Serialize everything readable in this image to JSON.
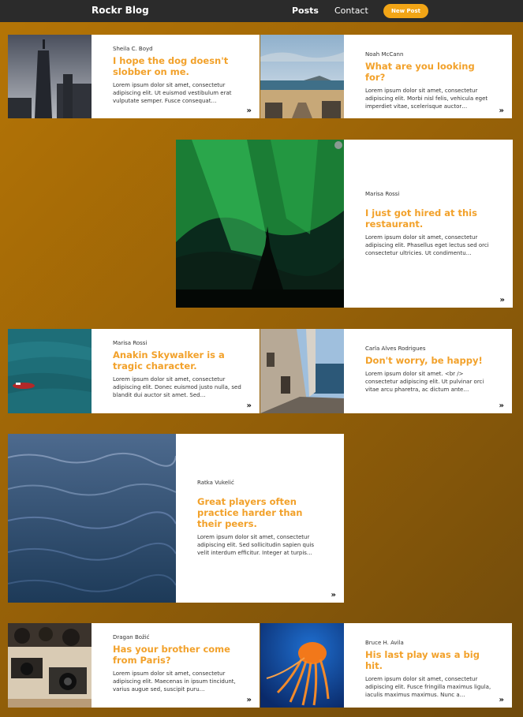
{
  "nav": {
    "brand": "Rockr Blog",
    "links": [
      "Posts",
      "Contact"
    ],
    "new_post_label": "New Post"
  },
  "colors": {
    "accent": "#f2a516",
    "title": "#f2a12a",
    "navbar": "#2b2b2b",
    "background_start": "#b57506",
    "background_end": "#6f4a0c"
  },
  "posts": [
    {
      "author": "Sheila C. Boyd",
      "title": "I hope the dog doesn't slobber on me.",
      "excerpt": "Lorem ipsum dolor sit amet, consectetur adipiscing elit. Ut euismod vestibulum erat vulputate semper. Fusce consequat…",
      "image": "city-skyscraper-photo"
    },
    {
      "author": "Noah McCann",
      "title": "What are you looking for?",
      "excerpt": "Lorem ipsum dolor sit amet, consectetur adipiscing elit. Morbi nisl felis, vehicula eget imperdiet vitae, scelerisque auctor…",
      "image": "beach-boardwalk-photo"
    },
    {
      "author": "Marisa Rossi",
      "title": "I just got hired at this restaurant.",
      "excerpt": "Lorem ipsum dolor sit amet, consectetur adipiscing elit. Phasellus eget lectus sed orci consectetur ultricies. Ut condimentu…",
      "image": "aurora-borealis-photo"
    },
    {
      "author": "Marisa Rossi",
      "title": "Anakin Skywalker is a tragic character.",
      "excerpt": "Lorem ipsum dolor sit amet, consectetur adipiscing elit. Donec euismod justo nulla, sed blandit dui auctor sit amet. Sed…",
      "image": "boat-on-sea-photo"
    },
    {
      "author": "Carla Alves Rodrigues",
      "title": "Don't worry, be happy!",
      "excerpt": "Lorem ipsum dolor sit amet. <br /> consectetur adipiscing elit. Ut pulvinar orci vitae arcu pharetra, ac dictum ante…",
      "image": "coastal-alley-photo"
    },
    {
      "author": "Ratka Vukelić",
      "title": "Great players often practice harder than their peers.",
      "excerpt": "Lorem ipsum dolor sit amet, consectetur adipiscing elit. Sed sollicitudin sapien quis velit interdum efficitur. Integer at turpis…",
      "image": "ocean-waves-photo"
    },
    {
      "author": "Dragan Božić",
      "title": "Has your brother come from Paris?",
      "excerpt": "Lorem ipsum dolor sit amet, consectetur adipiscing elit. Maecenas in ipsum tincidunt, varius augue sed, suscipit puru…",
      "image": "vintage-cameras-photo"
    },
    {
      "author": "Bruce H. Avila",
      "title": "His last play was a big hit.",
      "excerpt": "Lorem ipsum dolor sit amet, consectetur adipiscing elit. Fusce fringilla maximus ligula, iaculis maximus maximus. Nunc a…",
      "image": "jellyfish-photo"
    }
  ]
}
